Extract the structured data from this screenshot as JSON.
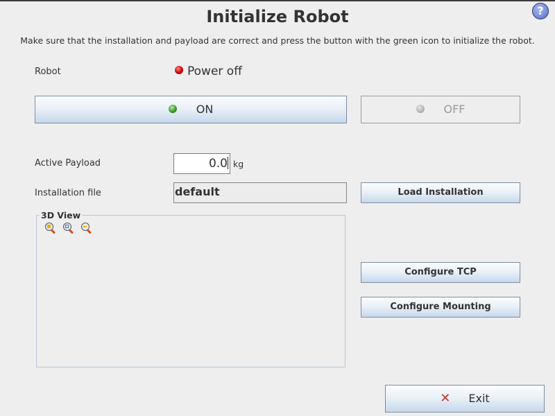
{
  "header": {
    "title": "Initialize Robot",
    "subtitle": "Make sure that the installation and payload are correct and press the button with the green icon to initialize the robot.",
    "help_icon": "question-icon",
    "help_glyph": "?"
  },
  "robot": {
    "label": "Robot",
    "status_text": "Power off",
    "status_color": "#c80000"
  },
  "power_buttons": {
    "on_label": "ON",
    "on_indicator": "green",
    "off_label": "OFF",
    "off_enabled": false
  },
  "payload": {
    "label": "Active Payload",
    "value": "0.0",
    "unit": "kg"
  },
  "installation": {
    "label": "Installation file",
    "value": "default",
    "load_button": "Load Installation"
  },
  "view3d": {
    "title": "3D View",
    "tools": [
      "zoom-in-icon",
      "zoom-fit-icon",
      "zoom-out-icon"
    ]
  },
  "actions": {
    "configure_tcp": "Configure TCP",
    "configure_mounting": "Configure Mounting",
    "exit": "Exit",
    "exit_glyph": "✕"
  }
}
